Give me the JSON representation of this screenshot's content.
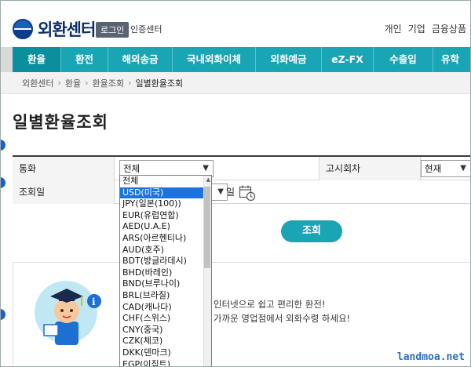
{
  "header": {
    "logo_text": "외환센터",
    "login_label": "로그인",
    "cert_label": "인증센터",
    "top_links": [
      "개인",
      "기업",
      "금융상품"
    ]
  },
  "nav": {
    "items": [
      "환율",
      "환전",
      "해외송금",
      "국내외화이체",
      "외화예금",
      "eZ-FX",
      "수출입",
      "유학"
    ]
  },
  "breadcrumb": [
    "외환센터",
    "환율",
    "환율조회",
    "일별환율조회"
  ],
  "page_title": "일별환율조회",
  "form": {
    "currency_label": "통화",
    "currency_value": "전체",
    "notice_label": "고시회차",
    "notice_value": "현재",
    "date_label": "조회일",
    "day_suffix": "일"
  },
  "query_button": "조회",
  "info": {
    "line1": "인터넷으로 쉽고 편리한 환전!",
    "line2": "가까운 영업점에서 외화수령 하세요!"
  },
  "dropdown": {
    "options": [
      "전체",
      "USD(미국)",
      "JPY(일본(100))",
      "EUR(유럽연합)",
      "AED(U.A.E)",
      "ARS(아르헨티나)",
      "AUD(호주)",
      "BDT(방글라데시)",
      "BHD(바레인)",
      "BND(브루나이)",
      "BRL(브라질)",
      "CAD(캐나다)",
      "CHF(스위스)",
      "CNY(중국)",
      "CZK(체코)",
      "DKK(덴마크)",
      "EGP(이집트)"
    ],
    "selected_index": 1
  },
  "watermark": "landmoa.net",
  "colors": {
    "accent": "#1aa5b4",
    "accent_dark": "#0b8f9d",
    "selected": "#1e72e0",
    "logo": "#0c2f6b"
  }
}
